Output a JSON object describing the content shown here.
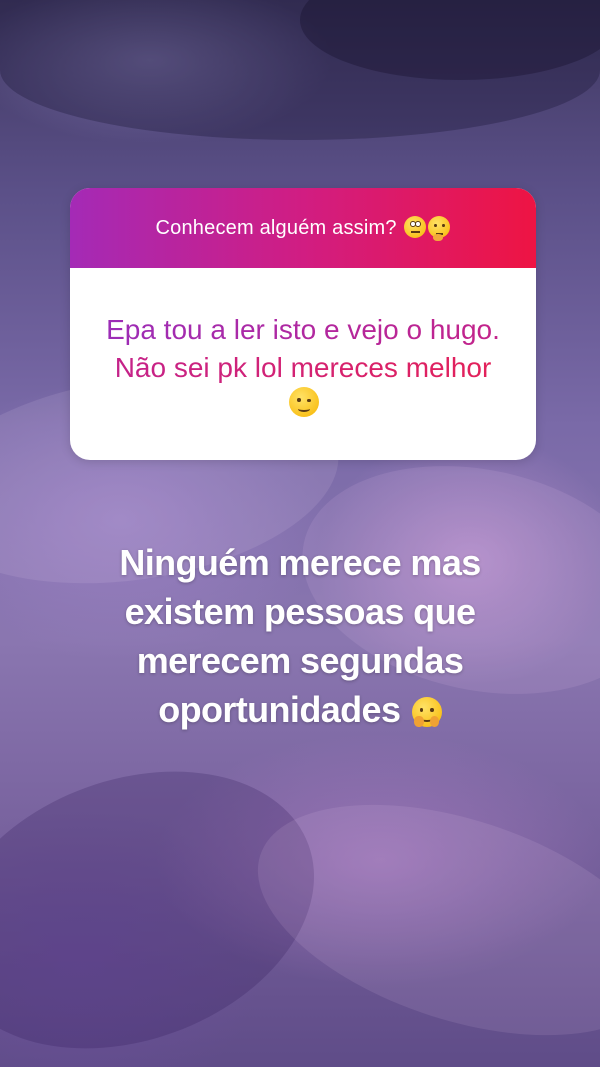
{
  "question_sticker": {
    "prompt": "Conhecem alguém assim?",
    "prompt_emojis": [
      "face-with-rolling-eyes-icon",
      "thinking-face-icon"
    ],
    "answer": "Epa tou a ler isto e vejo o hugo. Não sei pk lol mereces melhor",
    "answer_emoji": "winking-face-icon"
  },
  "caption": {
    "text": "Ninguém merece mas existem pessoas que merecem segundas oportunidades",
    "emoji": "hugging-face-icon"
  },
  "colors": {
    "header_gradient": [
      "#a42ab6",
      "#d11d82",
      "#ee1443"
    ],
    "answer_gradient": [
      "#9c2db7",
      "#c72286",
      "#e3215a"
    ],
    "card_background": "#ffffff",
    "caption_color": "#ffffff"
  }
}
